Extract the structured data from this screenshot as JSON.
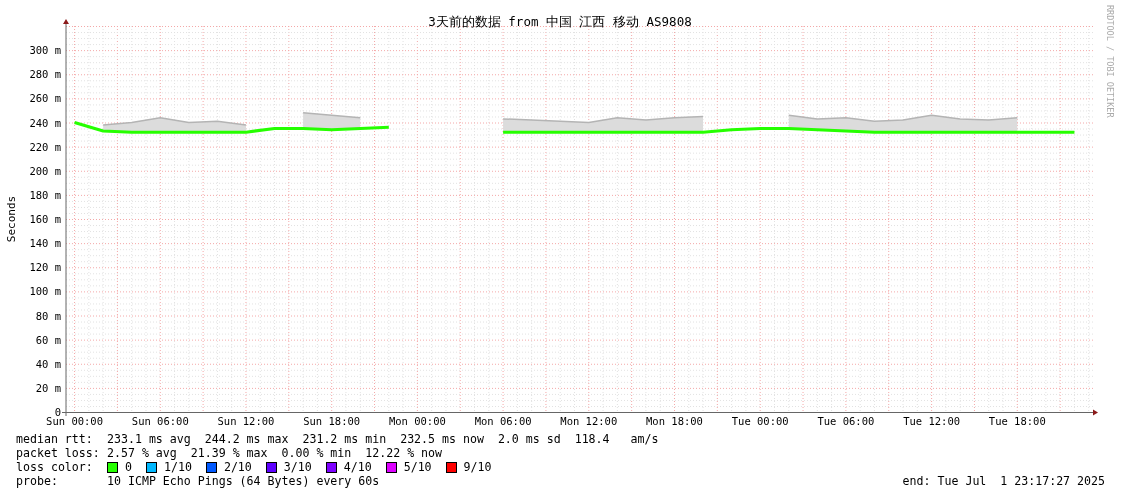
{
  "graph": {
    "watermark": "RRDTOOL / TOBI OETIKER",
    "chart_data": {
      "type": "line",
      "title": "3天前的数据 from 中国 江西 移动 AS9808",
      "ylabel": "Seconds",
      "ylim": [
        0,
        320
      ],
      "grid": true,
      "categories": [
        "Sun 00:00",
        null,
        null,
        "Sun 06:00",
        null,
        null,
        "Sun 12:00",
        null,
        null,
        "Sun 18:00",
        null,
        null,
        "Mon 00:00",
        null,
        null,
        "Mon 06:00",
        null,
        null,
        "Mon 12:00",
        null,
        null,
        "Mon 18:00",
        null,
        null,
        "Tue 00:00",
        null,
        null,
        "Tue 06:00",
        null,
        null,
        "Tue 12:00",
        null,
        null,
        "Tue 18:00",
        null,
        null
      ],
      "yticks": [
        {
          "value": 0,
          "label": "0"
        },
        {
          "value": 20,
          "label": "20 m"
        },
        {
          "value": 40,
          "label": "40 m"
        },
        {
          "value": 60,
          "label": "60 m"
        },
        {
          "value": 80,
          "label": "80 m"
        },
        {
          "value": 100,
          "label": "100 m"
        },
        {
          "value": 120,
          "label": "120 m"
        },
        {
          "value": 140,
          "label": "140 m"
        },
        {
          "value": 160,
          "label": "160 m"
        },
        {
          "value": 180,
          "label": "180 m"
        },
        {
          "value": 200,
          "label": "200 m"
        },
        {
          "value": 220,
          "label": "220 m"
        },
        {
          "value": 240,
          "label": "240 m"
        },
        {
          "value": 260,
          "label": "260 m"
        },
        {
          "value": 280,
          "label": "280 m"
        },
        {
          "value": 300,
          "label": "300 m"
        }
      ],
      "series": [
        {
          "color": "#b4b4b4",
          "values": [
            null,
            238,
            240,
            244,
            240,
            241,
            238,
            null,
            248,
            246,
            244,
            null,
            null,
            null,
            null,
            243,
            242,
            241,
            240,
            244,
            242,
            244,
            245,
            null,
            null,
            246,
            243,
            244,
            241,
            242,
            246,
            243,
            242,
            244,
            null,
            null
          ]
        },
        {
          "color": "#26ff00",
          "values": [
            240,
            233,
            232,
            232,
            232,
            232,
            232,
            235,
            235,
            234,
            235,
            236,
            null,
            null,
            null,
            232,
            232,
            232,
            232,
            232,
            232,
            232,
            232,
            234,
            235,
            235,
            234,
            233,
            232,
            232,
            232,
            232,
            232,
            232,
            232,
            232
          ]
        }
      ]
    }
  },
  "stats": [
    {
      "label": "median rtt:",
      "text": "233.1 ms avg  244.2 ms max  231.2 ms min  232.5 ms now  2.0 ms sd  118.4   am/s"
    },
    {
      "label": "packet loss:",
      "text": "2.57 % avg  21.39 % max  0.00 % min  12.22 % now"
    }
  ],
  "loss_color": {
    "label": "loss color:",
    "items": [
      {
        "label": "0",
        "color": "#26ff00"
      },
      {
        "label": "1/10",
        "color": "#00b8ff"
      },
      {
        "label": "2/10",
        "color": "#0059ff"
      },
      {
        "label": "3/10",
        "color": "#5e00ff"
      },
      {
        "label": "4/10",
        "color": "#7e00ff"
      },
      {
        "label": "5/10",
        "color": "#dd00ff"
      },
      {
        "label": "9/10",
        "color": "#ff0000"
      }
    ]
  },
  "probe": {
    "label": "probe:",
    "text": "10 ICMP Echo Pings (64 Bytes) every 60s"
  },
  "end": "end: Tue Jul  1 23:17:27 2025"
}
